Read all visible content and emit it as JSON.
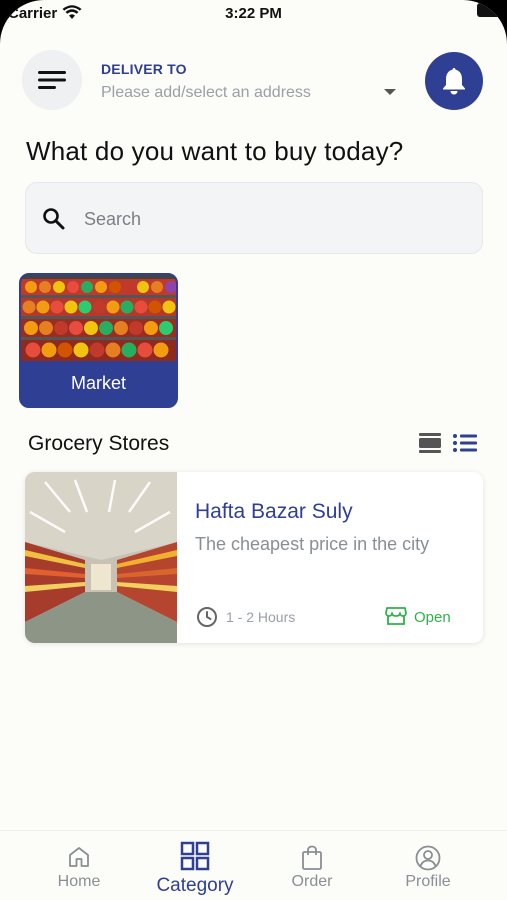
{
  "status_bar": {
    "carrier": "Carrier",
    "time": "3:22 PM"
  },
  "header": {
    "deliver_label": "DELIVER TO",
    "address_placeholder": "Please add/select an address"
  },
  "headline": "What do you want to buy today?",
  "search": {
    "placeholder": "Search"
  },
  "categories": [
    {
      "label": "Market"
    }
  ],
  "section": {
    "title": "Grocery Stores"
  },
  "stores": [
    {
      "name": "Hafta Bazar Suly",
      "description": "The cheapest price in the city",
      "eta": "1 - 2 Hours",
      "status": "Open"
    }
  ],
  "bottom_nav": [
    {
      "label": "Home",
      "icon": "home-icon",
      "active": false
    },
    {
      "label": "Category",
      "icon": "category-icon",
      "active": true
    },
    {
      "label": "Order",
      "icon": "bag-icon",
      "active": false
    },
    {
      "label": "Profile",
      "icon": "profile-icon",
      "active": false
    }
  ],
  "colors": {
    "primary": "#2f3f93",
    "open": "#2db34a",
    "muted": "#8a8f95"
  }
}
